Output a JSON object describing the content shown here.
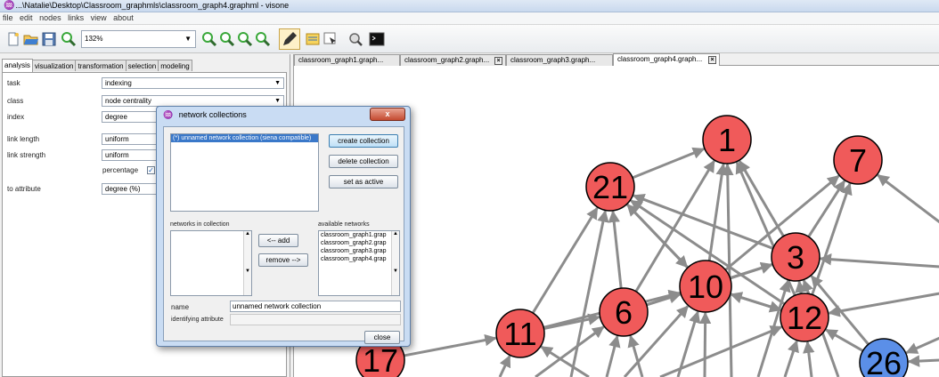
{
  "window": {
    "title": "...\\Natalie\\Desktop\\Classroom_graphmls\\classroom_graph4.graphml - visone"
  },
  "menu": {
    "items": [
      "file",
      "edit",
      "nodes",
      "links",
      "view",
      "about"
    ]
  },
  "toolbar": {
    "zoom_value": "132%",
    "icons": [
      "new-file-icon",
      "open-folder-icon",
      "save-disk-icon",
      "zoom-icon",
      "zoom-in-icon",
      "zoom-out-icon",
      "zoom-fit-icon",
      "zoom-selection-icon",
      "edit-pencil-icon",
      "properties-icon",
      "select-cursor-icon",
      "analysis-icon",
      "console-icon"
    ]
  },
  "left_panel": {
    "tabs": [
      {
        "label": "analysis",
        "active": true
      },
      {
        "label": "visualization",
        "active": false
      },
      {
        "label": "transformation",
        "active": false
      },
      {
        "label": "selection",
        "active": false
      },
      {
        "label": "modeling",
        "active": false
      }
    ],
    "task_label": "task",
    "task_value": "indexing",
    "class_label": "class",
    "class_value": "node centrality",
    "index_label": "index",
    "index_value": "degree",
    "link_length_label": "link length",
    "link_length_value": "uniform",
    "link_strength_label": "link strength",
    "link_strength_value": "uniform",
    "percentage_label": "percentage",
    "percentage_checked": true,
    "to_attribute_label": "to attribute",
    "to_attribute_value": "degree (%)"
  },
  "doc_tabs": [
    {
      "label": "classroom_graph1.graph...",
      "active": false,
      "closable": false
    },
    {
      "label": "classroom_graph2.graph...",
      "active": false,
      "closable": true
    },
    {
      "label": "classroom_graph3.graph...",
      "active": false,
      "closable": false
    },
    {
      "label": "classroom_graph4.graph...",
      "active": true,
      "closable": true
    }
  ],
  "dialog": {
    "title": "network collections",
    "close_symbol": "x",
    "collections": [
      "(*) unnamed network collection (siena compatible)"
    ],
    "buttons": {
      "create": "create collection",
      "delete": "delete collection",
      "set_active": "set as active",
      "add": "<-- add",
      "remove": "remove -->",
      "close": "close"
    },
    "networks_in_collection_label": "networks in collection",
    "available_networks_label": "available networks",
    "available_networks": [
      "classroom_graph1.grap",
      "classroom_graph2.grap",
      "classroom_graph3.grap",
      "classroom_graph4.grap"
    ],
    "name_label": "name",
    "name_value": "unnamed network collection",
    "identifying_attribute_label": "identifying attribute",
    "identifying_attribute_value": ""
  },
  "graph": {
    "colors": {
      "node_red": "#f05a5a",
      "node_blue": "#5b8fe8",
      "edge": "#8c8c8c"
    },
    "nodes": [
      {
        "label": "1",
        "color": "red"
      },
      {
        "label": "7",
        "color": "red"
      },
      {
        "label": "21",
        "color": "red"
      },
      {
        "label": "3",
        "color": "red"
      },
      {
        "label": "10",
        "color": "red"
      },
      {
        "label": "6",
        "color": "red"
      },
      {
        "label": "12",
        "color": "red"
      },
      {
        "label": "11",
        "color": "red"
      },
      {
        "label": "17",
        "color": "red"
      },
      {
        "label": "26",
        "color": "blue"
      }
    ]
  }
}
